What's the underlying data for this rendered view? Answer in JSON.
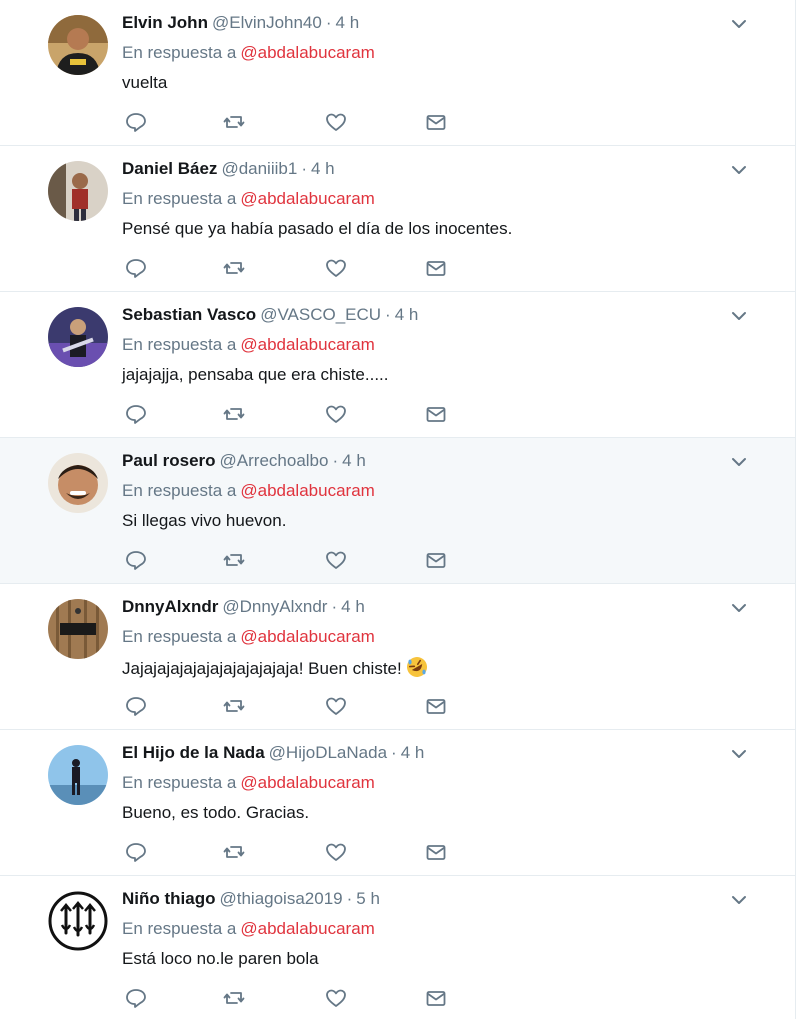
{
  "reply_prefix": "En respuesta a",
  "icons": {
    "reply": "reply-icon",
    "retweet": "retweet-icon",
    "like": "heart-icon",
    "dm": "envelope-icon",
    "caret": "chevron-down-icon"
  },
  "colors": {
    "name": "#14171a",
    "muted": "#657786",
    "mention": "#e0343e",
    "highlight_bg": "#f5f8fa"
  },
  "tweets": [
    {
      "name": "Elvin John",
      "handle": "@ElvinJohn40",
      "dot": "·",
      "time": "4 h",
      "reply_to": "@abdalabucaram",
      "text": "vuelta"
    },
    {
      "name": "Daniel Báez",
      "handle": "@daniiib1",
      "dot": "·",
      "time": "4 h",
      "reply_to": "@abdalabucaram",
      "text": "Pensé que ya había pasado el día de los inocentes."
    },
    {
      "name": "Sebastian Vasco",
      "handle": "@VASCO_ECU",
      "dot": "·",
      "time": "4 h",
      "reply_to": "@abdalabucaram",
      "text": "jajajajja, pensaba que era chiste....."
    },
    {
      "name": "Paul rosero",
      "handle": "@Arrechoalbo",
      "dot": "·",
      "time": "4 h",
      "reply_to": "@abdalabucaram",
      "text": "Si llegas vivo huevon."
    },
    {
      "name": "DnnyAlxndr",
      "handle": "@DnnyAlxndr",
      "dot": "·",
      "time": "4 h",
      "reply_to": "@abdalabucaram",
      "text": "Jajajajajajajajajajajajaja! Buen chiste!",
      "emoji": "rolling-on-floor-laughing-emoji"
    },
    {
      "name": "El Hijo de la Nada",
      "handle": "@HijoDLaNada",
      "dot": "·",
      "time": "4 h",
      "reply_to": "@abdalabucaram",
      "text": "Bueno, es todo. Gracias."
    },
    {
      "name": "Niño thiago",
      "handle": "@thiagoisa2019",
      "dot": "·",
      "time": "5 h",
      "reply_to": "@abdalabucaram",
      "text": "Está loco no.le paren bola"
    }
  ]
}
